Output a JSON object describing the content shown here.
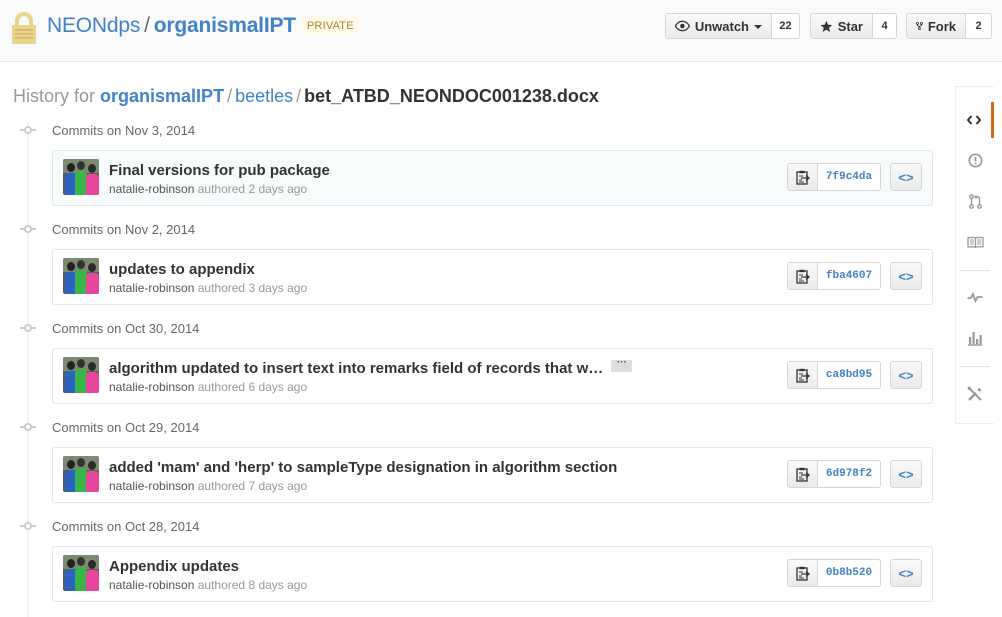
{
  "repo": {
    "owner": "NEONdps",
    "separator": "/",
    "name": "organismalIPT",
    "visibility_label": "PRIVATE"
  },
  "actions": {
    "watch": {
      "label": "Unwatch",
      "count": "22"
    },
    "star": {
      "label": "Star",
      "count": "4"
    },
    "fork": {
      "label": "Fork",
      "count": "2"
    }
  },
  "breadcrumb": {
    "prefix": "History for",
    "repo": "organismalIPT",
    "folder": "beetles",
    "file": "bet_ATBD_NEONDOC001238.docx",
    "sep": "/"
  },
  "commit_groups": [
    {
      "heading": "Commits on Nov 3, 2014",
      "commit": {
        "message": "Final versions for pub package",
        "author": "natalie-robinson",
        "authored": "authored 2 days ago",
        "sha": "7f9c4da",
        "truncated": false
      }
    },
    {
      "heading": "Commits on Nov 2, 2014",
      "commit": {
        "message": "updates to appendix",
        "author": "natalie-robinson",
        "authored": "authored 3 days ago",
        "sha": "fba4607",
        "truncated": false
      }
    },
    {
      "heading": "Commits on Oct 30, 2014",
      "commit": {
        "message": "algorithm updated to insert text into remarks field of records that w…",
        "ellipsis": "···",
        "author": "natalie-robinson",
        "authored": "authored 6 days ago",
        "sha": "ca8bd95",
        "truncated": true
      }
    },
    {
      "heading": "Commits on Oct 29, 2014",
      "commit": {
        "message": "added 'mam' and 'herp' to sampleType designation in algorithm section",
        "author": "natalie-robinson",
        "authored": "authored 7 days ago",
        "sha": "6d978f2",
        "truncated": false
      }
    },
    {
      "heading": "Commits on Oct 28, 2014",
      "commit": {
        "message": "Appendix updates",
        "author": "natalie-robinson",
        "authored": "authored 8 days ago",
        "sha": "0b8b520",
        "truncated": false
      }
    }
  ],
  "sidenav": {
    "items": [
      {
        "icon": "code-icon",
        "selected": true
      },
      {
        "icon": "issue-icon",
        "selected": false
      },
      {
        "icon": "pull-request-icon",
        "selected": false
      },
      {
        "icon": "wiki-book-icon",
        "selected": false
      },
      {
        "icon": "pulse-icon",
        "selected": false
      },
      {
        "icon": "graph-icon",
        "selected": false
      },
      {
        "icon": "settings-tools-icon",
        "selected": false
      }
    ]
  },
  "colors": {
    "link": "#4183c4",
    "selected_nav_accent": "#d26911",
    "private_label_text": "#a1882b",
    "private_label_bg": "#fff9ea"
  }
}
